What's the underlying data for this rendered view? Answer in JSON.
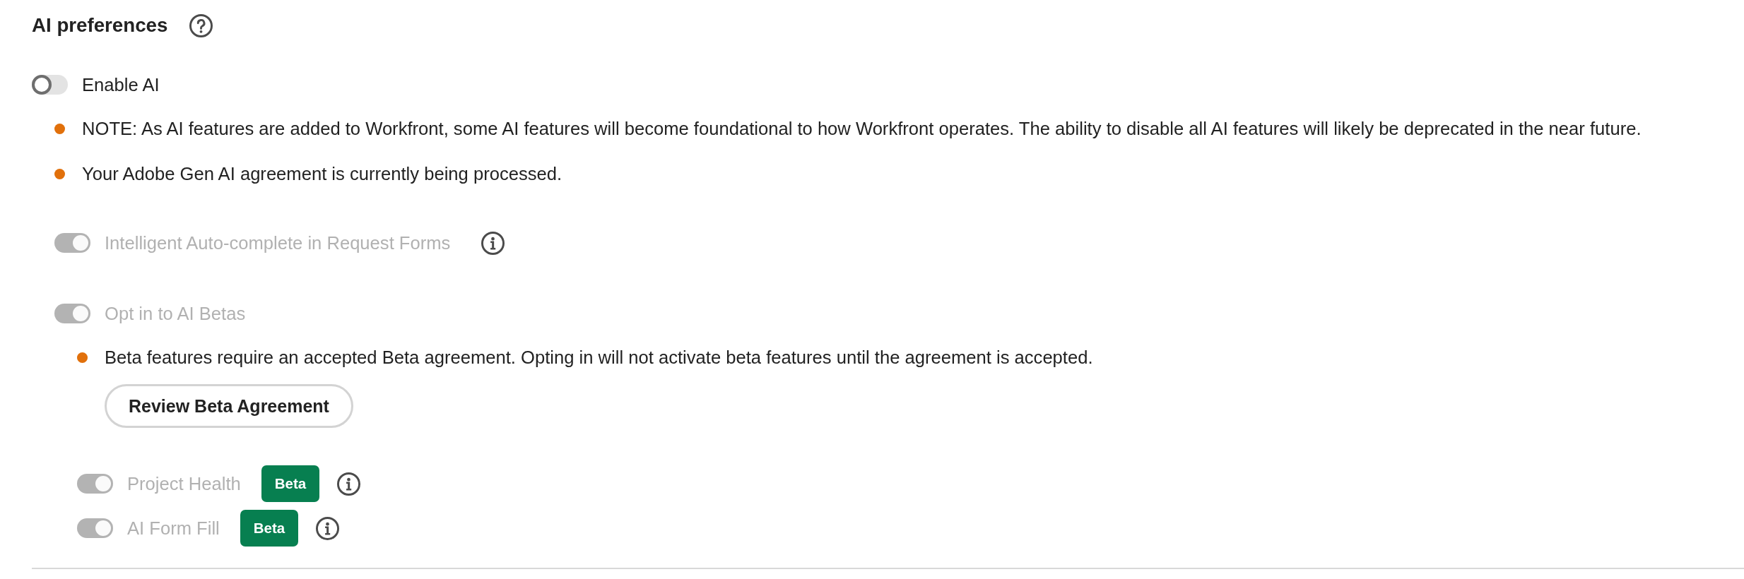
{
  "section": {
    "title": "AI preferences"
  },
  "settings": [
    {
      "label": "Enable AI",
      "on": false,
      "disabled": false,
      "info": false,
      "notes": [
        "NOTE: As AI features are added to Workfront, some AI features will become foundational to how Workfront operates. The ability to disable all AI features will likely be deprecated in the near future.",
        "Your Adobe Gen AI agreement is currently being processed."
      ],
      "children": [
        {
          "label": "Intelligent Auto-complete in Request Forms",
          "on": true,
          "disabled": true,
          "info": true
        },
        {
          "label": "Opt in to AI Betas",
          "on": true,
          "disabled": true,
          "info": false,
          "notes": [
            "Beta features require an accepted Beta agreement. Opting in will not activate beta features until the agreement is accepted."
          ],
          "button": {
            "label": "Review Beta Agreement"
          },
          "children": [
            {
              "label": "Project Health",
              "on": true,
              "disabled": true,
              "badge": "Beta",
              "info": true
            },
            {
              "label": "AI Form Fill",
              "on": true,
              "disabled": true,
              "badge": "Beta",
              "info": true
            }
          ]
        }
      ]
    }
  ]
}
